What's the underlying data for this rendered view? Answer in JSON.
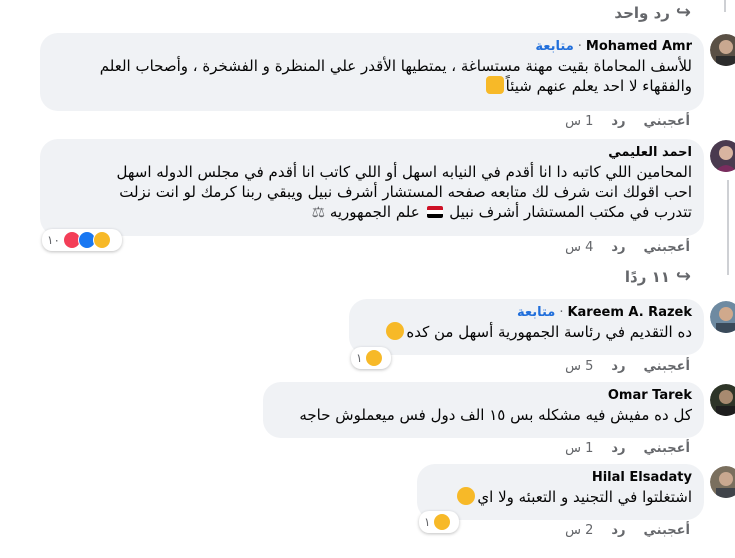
{
  "colors": {
    "bubble": "#f0f2f5",
    "link": "#216fdb",
    "meta": "#65676b",
    "haha": "#f7b928",
    "love": "#f33e58",
    "like": "#1877f2"
  },
  "top_reply": {
    "label": "رد واحد",
    "icon": "reply-arrow-icon"
  },
  "comments": [
    {
      "name": "Mohamed Amr",
      "follow": "متابعة",
      "lines": [
        "للأسف المحاماة بقيت مهنة مستساغة ، يمتطيها الأقدر علي المنظرة و الفشخرة ، وأصحاب العلم",
        "والفقهاء لا احد يعلم عنهم شيئاً"
      ],
      "emoji": "raised-hand-icon",
      "like": "أعجبني",
      "reply": "رد",
      "time": "1 س"
    },
    {
      "name": "احمد العليمي",
      "lines": [
        "المحامين اللي كاتبه دا انا أقدم في النيابه اسهل أو اللي كاتب انا أقدم في مجلس الدوله اسهل",
        "احب اقولك انت شرف لك متابعه صفحه المستشار أشرف نبيل ويبقي ربنا كرمك لو انت نزلت",
        "تتدرب في مكتب المستشار أشرف نبيل",
        "علم الجمهوريه"
      ],
      "reactions": {
        "count": "١٠",
        "icons": [
          "haha-icon",
          "like-icon",
          "love-icon"
        ]
      },
      "like": "أعجبني",
      "reply": "رد",
      "time": "4 س"
    },
    {
      "name": "Kareem A. Razek",
      "follow": "متابعة",
      "lines": [
        "ده التقديم في رئاسة الجمهورية أسهل من كده"
      ],
      "emoji": "pensive-face-icon",
      "reactions": {
        "count": "١",
        "icons": [
          "haha-icon"
        ]
      },
      "like": "أعجبني",
      "reply": "رد",
      "time": "5 س"
    },
    {
      "name": "Omar Tarek",
      "lines": [
        "كل ده مفيش فيه مشكله بس ١٥ الف دول فس ميعملوش حاجه"
      ],
      "like": "أعجبني",
      "reply": "رد",
      "time": "1 س"
    },
    {
      "name": "Hilal Elsadaty",
      "lines": [
        "اشتغلتوا في التجنيد و التعبئه ولا اي"
      ],
      "emoji": "expressionless-face-icon",
      "reactions": {
        "count": "١",
        "icons": [
          "haha-icon"
        ]
      },
      "like": "أعجبني",
      "reply": "رد",
      "time": "2 س"
    }
  ],
  "mid_reply": {
    "label": "١١ ردًا",
    "icon": "reply-arrow-icon"
  }
}
